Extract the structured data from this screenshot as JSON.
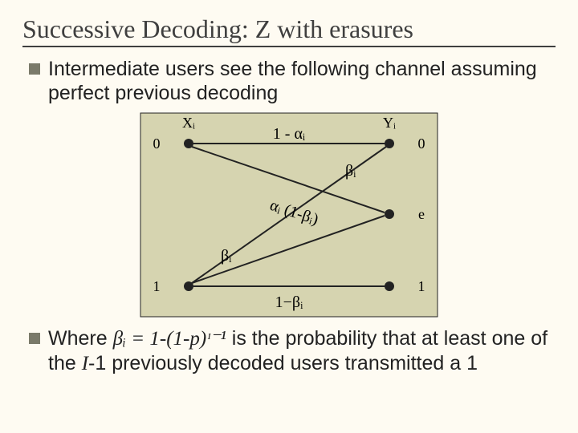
{
  "title": "Successive Decoding: Z with erasures",
  "bullet1": "Intermediate users see the following channel assuming perfect previous decoding",
  "bullet2_pre": "Where ",
  "bullet2_formula": "βᵢ = 1-(1-p)ᶦ⁻¹",
  "bullet2_post": " is the probability that at least one of the ",
  "bullet2_I": "I",
  "bullet2_post2": "-1 previously decoded users transmitted a 1",
  "diagram": {
    "Xi": "Xᵢ",
    "Yi": "Yᵢ",
    "left0": "0",
    "left1": "1",
    "right0": "0",
    "rightE": "e",
    "right1": "1",
    "top_prob": "1 - αᵢ",
    "beta_upper": "βᵢ",
    "alpha_mid": "αᵢ (1-βᵢ)",
    "beta_lower": "βᵢ",
    "bottom_prob": "1−βᵢ"
  }
}
